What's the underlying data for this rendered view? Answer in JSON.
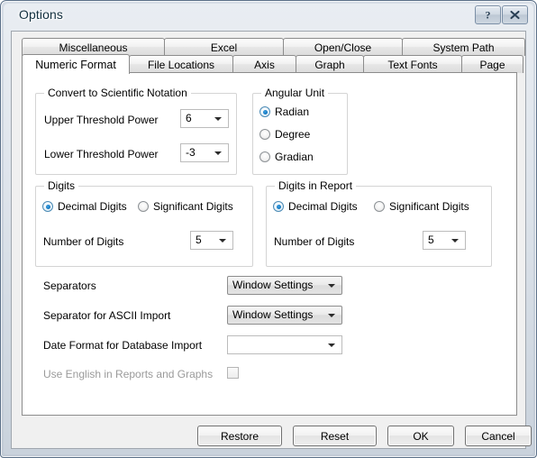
{
  "window": {
    "title": "Options",
    "caption_buttons": [
      {
        "name": "help",
        "label": "?"
      },
      {
        "name": "close",
        "label": "X"
      }
    ]
  },
  "tabs": {
    "row1": [
      {
        "label": "Miscellaneous",
        "selected": false
      },
      {
        "label": "Excel",
        "selected": false
      },
      {
        "label": "Open/Close",
        "selected": false
      },
      {
        "label": "System Path",
        "selected": false
      }
    ],
    "row2": [
      {
        "label": "Numeric Format",
        "selected": true
      },
      {
        "label": "File Locations",
        "selected": false
      },
      {
        "label": "Axis",
        "selected": false
      },
      {
        "label": "Graph",
        "selected": false
      },
      {
        "label": "Text Fonts",
        "selected": false
      },
      {
        "label": "Page",
        "selected": false
      }
    ]
  },
  "scientific_notation": {
    "group_label": "Convert to Scientific Notation",
    "upper": {
      "label": "Upper Threshold Power",
      "value": "6"
    },
    "lower": {
      "label": "Lower Threshold Power",
      "value": "-3"
    }
  },
  "angular_unit": {
    "group_label": "Angular Unit",
    "options": [
      {
        "label": "Radian",
        "checked": true
      },
      {
        "label": "Degree",
        "checked": false
      },
      {
        "label": "Gradian",
        "checked": false
      }
    ]
  },
  "digits": {
    "group_label": "Digits",
    "mode": [
      {
        "label": "Decimal Digits",
        "checked": true
      },
      {
        "label": "Significant Digits",
        "checked": false
      }
    ],
    "number_label": "Number of Digits",
    "number_value": "5"
  },
  "digits_in_report": {
    "group_label": "Digits in Report",
    "mode": [
      {
        "label": "Decimal Digits",
        "checked": true
      },
      {
        "label": "Significant Digits",
        "checked": false
      }
    ],
    "number_label": "Number of Digits",
    "number_value": "5"
  },
  "settings": {
    "separators": {
      "label": "Separators",
      "value": "Window Settings"
    },
    "ascii_separator": {
      "label": "Separator for ASCII Import",
      "value": "Window Settings"
    },
    "date_format": {
      "label": "Date Format for Database Import",
      "value": ""
    },
    "use_english": {
      "label": "Use English in Reports and Graphs",
      "checked": false,
      "disabled": true
    }
  },
  "buttons": [
    {
      "label": "Restore"
    },
    {
      "label": "Reset"
    },
    {
      "label": "OK"
    },
    {
      "label": "Cancel"
    }
  ],
  "colors": {
    "accent_radio": "#0f74bd",
    "title_text": "#13303f",
    "panel_bg": "#ffffff",
    "dialog_bg": "#f0f0f0"
  }
}
